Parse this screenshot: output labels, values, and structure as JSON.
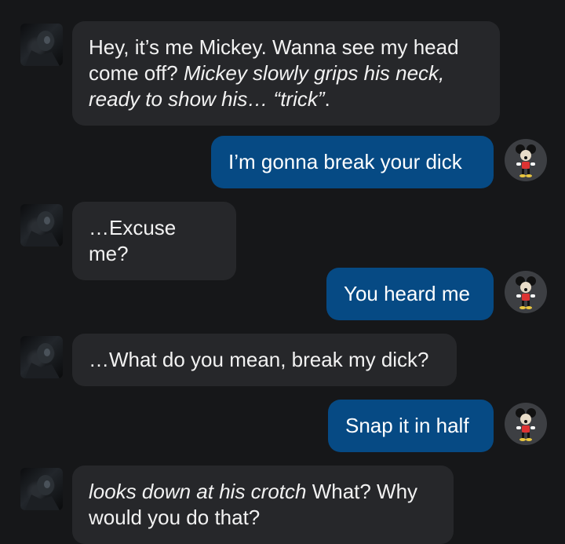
{
  "colors": {
    "background": "#161719",
    "bot_bubble": "#26272a",
    "user_bubble": "#064a84",
    "text": "#ffffff"
  },
  "messages": [
    {
      "sender": "bot",
      "avatar": "bot-avatar-icon",
      "parts": [
        {
          "text": "Hey, it’s me Mickey. Wanna see my head come off? ",
          "italic": false
        },
        {
          "text": "Mickey slowly grips his neck, ready to show his… “trick”",
          "italic": true
        },
        {
          "text": ".",
          "italic": false
        }
      ]
    },
    {
      "sender": "user",
      "avatar": "user-avatar-icon",
      "parts": [
        {
          "text": "I’m gonna break your dick",
          "italic": false
        }
      ]
    },
    {
      "sender": "bot",
      "avatar": "bot-avatar-icon",
      "parts": [
        {
          "text": "…Excuse me?",
          "italic": false
        }
      ]
    },
    {
      "sender": "user",
      "avatar": "user-avatar-icon",
      "parts": [
        {
          "text": "You heard me",
          "italic": false
        }
      ]
    },
    {
      "sender": "bot",
      "avatar": "bot-avatar-icon",
      "parts": [
        {
          "text": "…What do you mean, break my dick?",
          "italic": false
        }
      ]
    },
    {
      "sender": "user",
      "avatar": "user-avatar-icon",
      "parts": [
        {
          "text": "Snap it in half",
          "italic": false
        }
      ]
    },
    {
      "sender": "bot",
      "avatar": "bot-avatar-icon",
      "parts": [
        {
          "text": "looks down at his crotch",
          "italic": true
        },
        {
          "text": " What? Why would you do that?",
          "italic": false
        }
      ]
    }
  ]
}
